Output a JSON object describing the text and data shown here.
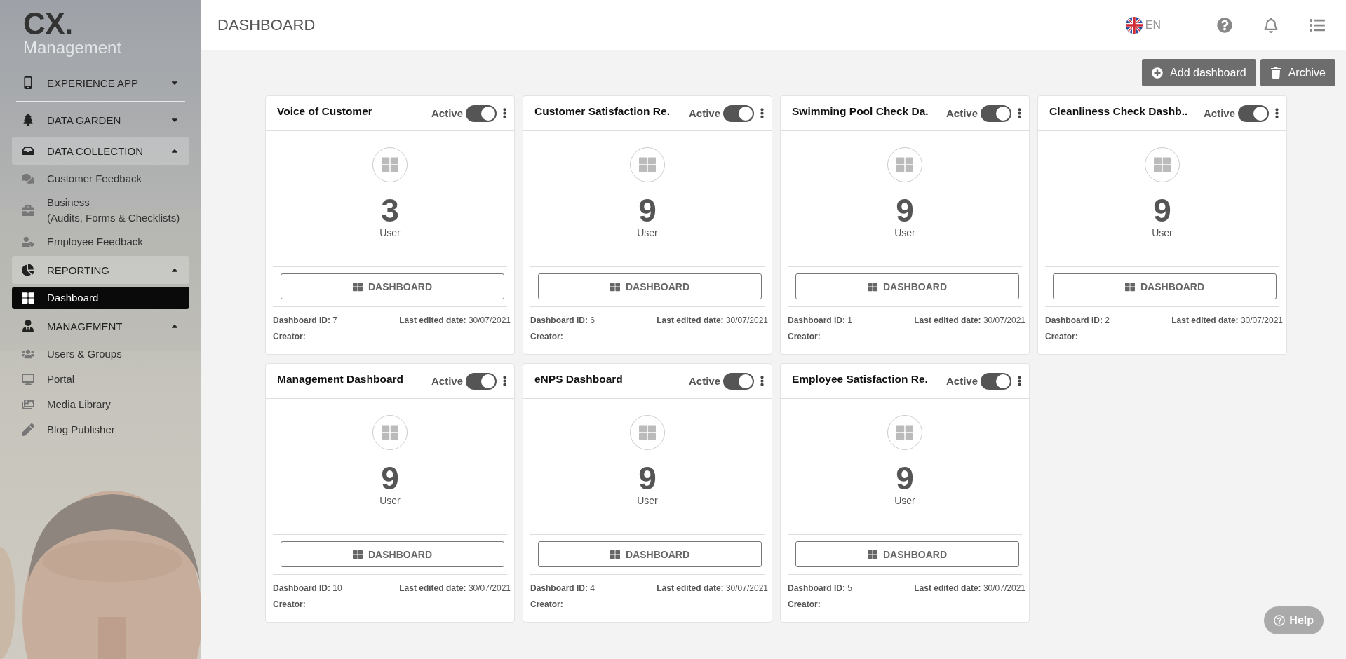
{
  "brand": {
    "logo": "CX.",
    "subtitle": "Management"
  },
  "sidebar": {
    "sections": [
      {
        "label": "EXPERIENCE APP",
        "expanded": false,
        "highlighted": false
      },
      {
        "label": "DATA GARDEN",
        "expanded": false,
        "highlighted": false
      },
      {
        "label": "DATA COLLECTION",
        "expanded": true,
        "highlighted": true,
        "children": [
          {
            "label": "Customer Feedback",
            "selected": false
          },
          {
            "label": "Business\n(Audits, Forms & Checklists)",
            "selected": false
          },
          {
            "label": "Employee Feedback",
            "selected": false
          }
        ]
      },
      {
        "label": "REPORTING",
        "expanded": true,
        "highlighted": true,
        "children": [
          {
            "label": "Dashboard",
            "selected": true
          }
        ]
      },
      {
        "label": "MANAGEMENT",
        "expanded": true,
        "highlighted": false,
        "children": [
          {
            "label": "Users & Groups",
            "selected": false
          },
          {
            "label": "Portal",
            "selected": false
          },
          {
            "label": "Media Library",
            "selected": false
          },
          {
            "label": "Blog Publisher",
            "selected": false
          }
        ]
      }
    ]
  },
  "header": {
    "title": "DASHBOARD",
    "language": "EN"
  },
  "actions": [
    "Add dashboard",
    "Archive"
  ],
  "cards": [
    {
      "title": "Voice of Customer",
      "status": "Active",
      "active": true,
      "count": "3",
      "count_label": "User",
      "button": "DASHBOARD",
      "id_label": "Dashboard ID:",
      "id": "7",
      "date_label": "Last edited date:",
      "date": "30/07/2021",
      "creator_label": "Creator:"
    },
    {
      "title": "Customer Satisfaction Re.",
      "status": "Active",
      "active": true,
      "count": "9",
      "count_label": "User",
      "button": "DASHBOARD",
      "id_label": "Dashboard ID:",
      "id": "6",
      "date_label": "Last edited date:",
      "date": "30/07/2021",
      "creator_label": "Creator:"
    },
    {
      "title": "Swimming Pool Check Da.",
      "status": "Active",
      "active": true,
      "count": "9",
      "count_label": "User",
      "button": "DASHBOARD",
      "id_label": "Dashboard ID:",
      "id": "1",
      "date_label": "Last edited date:",
      "date": "30/07/2021",
      "creator_label": "Creator:"
    },
    {
      "title": "Cleanliness Check Dashb..",
      "status": "Active",
      "active": true,
      "count": "9",
      "count_label": "User",
      "button": "DASHBOARD",
      "id_label": "Dashboard ID:",
      "id": "2",
      "date_label": "Last edited date:",
      "date": "30/07/2021",
      "creator_label": "Creator:"
    },
    {
      "title": "Management Dashboard",
      "status": "Active",
      "active": true,
      "count": "9",
      "count_label": "User",
      "button": "DASHBOARD",
      "id_label": "Dashboard ID:",
      "id": "10",
      "date_label": "Last edited date:",
      "date": "30/07/2021",
      "creator_label": "Creator:"
    },
    {
      "title": "eNPS Dashboard",
      "status": "Active",
      "active": true,
      "count": "9",
      "count_label": "User",
      "button": "DASHBOARD",
      "id_label": "Dashboard ID:",
      "id": "4",
      "date_label": "Last edited date:",
      "date": "30/07/2021",
      "creator_label": "Creator:"
    },
    {
      "title": "Employee Satisfaction Re.",
      "status": "Active",
      "active": true,
      "count": "9",
      "count_label": "User",
      "button": "DASHBOARD",
      "id_label": "Dashboard ID:",
      "id": "5",
      "date_label": "Last edited date:",
      "date": "30/07/2021",
      "creator_label": "Creator:"
    }
  ],
  "help": "Help"
}
